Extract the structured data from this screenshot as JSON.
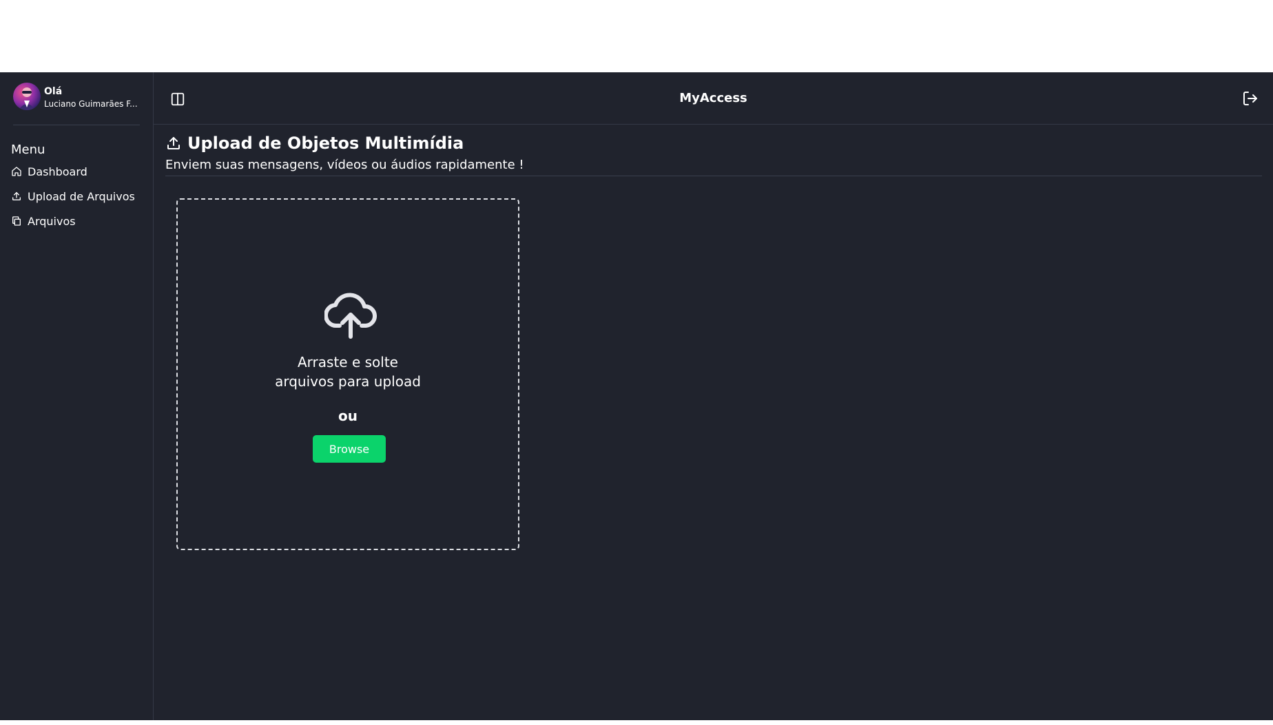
{
  "app": {
    "title": "MyAccess"
  },
  "user": {
    "greeting": "Olá",
    "name": "Luciano Guimarães F..."
  },
  "sidebar": {
    "menu_title": "Menu",
    "items": [
      {
        "label": "Dashboard",
        "icon": "home-icon"
      },
      {
        "label": "Upload de Arquivos",
        "icon": "upload-icon"
      },
      {
        "label": "Arquivos",
        "icon": "copy-icon"
      }
    ]
  },
  "page": {
    "title": "Upload de Objetos Multimídia",
    "subtitle": "Enviem suas mensagens, vídeos ou áudios rapidamente !"
  },
  "dropzone": {
    "line1": "Arraste e solte",
    "line2": "arquivos para upload",
    "or": "ou",
    "button": "Browse",
    "icon": "cloud-upload-icon"
  },
  "colors": {
    "background": "#20232d",
    "accent": "#0bd36b",
    "text": "#ffffff"
  }
}
